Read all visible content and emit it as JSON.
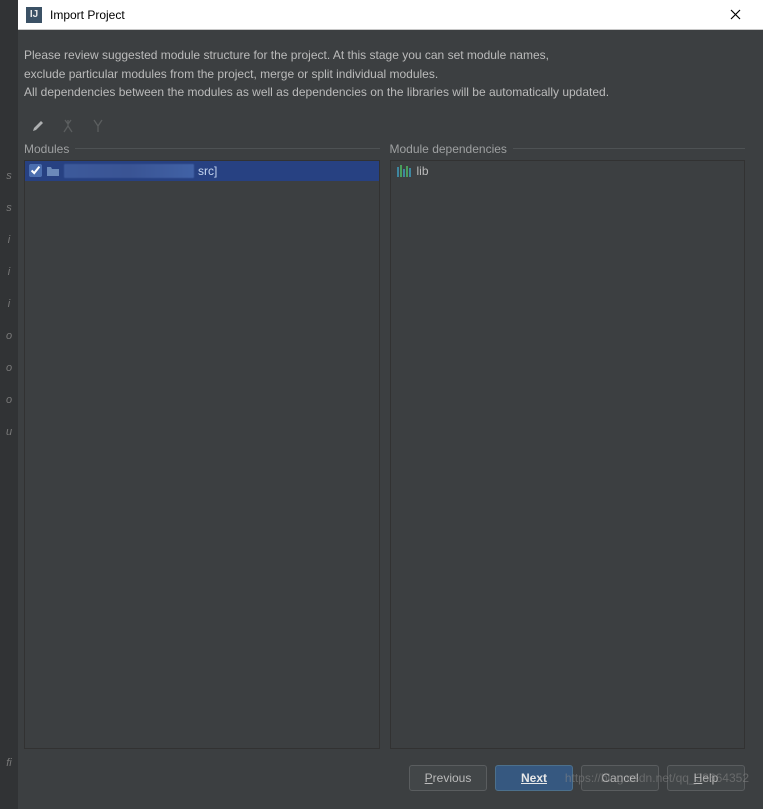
{
  "titlebar": {
    "title": "Import Project"
  },
  "intro": {
    "line1": "Please review suggested module structure for the project. At this stage you can set module names,",
    "line2": "exclude particular modules from the project, merge or split individual modules.",
    "line3": "All dependencies between the modules as well as dependencies on the libraries will be automatically updated."
  },
  "panels": {
    "modules_label": "Modules",
    "dependencies_label": "Module dependencies"
  },
  "modules": [
    {
      "checked": true,
      "name_obscured": true,
      "suffix": "src]"
    }
  ],
  "dependencies": [
    {
      "name": "lib"
    }
  ],
  "buttons": {
    "previous": "Previous",
    "next": "Next",
    "cancel": "Cancel",
    "help": "Help"
  },
  "watermark": "https://blog.csdn.net/qq_38664352"
}
